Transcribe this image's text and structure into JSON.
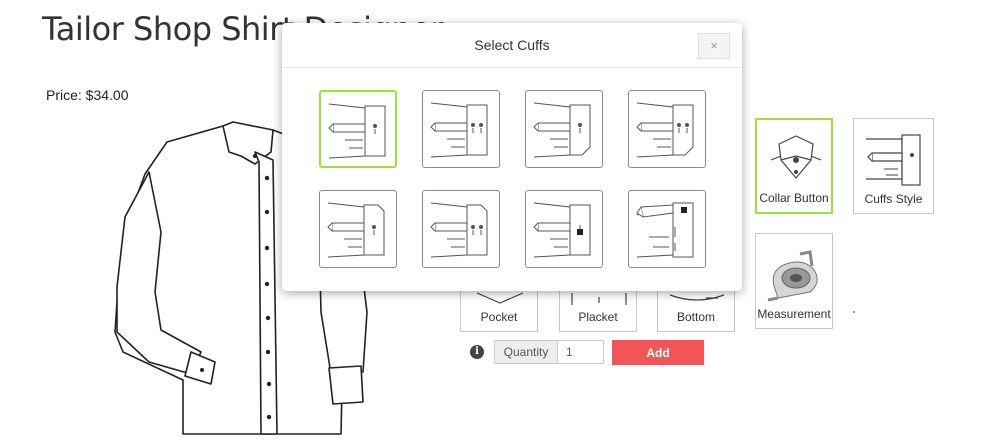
{
  "page": {
    "title": "Tailor Shop Shirt Designer",
    "price": "Price: $34.00"
  },
  "options": [
    {
      "label": "Collar Button",
      "icon": "collar-button-icon",
      "selected": true
    },
    {
      "label": "Cuffs Style",
      "icon": "cuffs-style-icon",
      "selected": false
    },
    {
      "label": "Pocket",
      "icon": "pocket-icon",
      "selected": false
    },
    {
      "label": "Placket",
      "icon": "placket-icon",
      "selected": false
    },
    {
      "label": "Bottom",
      "icon": "bottom-icon",
      "selected": false
    },
    {
      "label": "Measurement",
      "icon": "measuring-tape-icon",
      "selected": false
    }
  ],
  "cart": {
    "info_icon": "i",
    "quantity_label": "Quantity",
    "quantity_value": "1",
    "add_label": "Add"
  },
  "modal": {
    "title": "Select Cuffs",
    "close_label": "×",
    "cuffs": [
      {
        "icon": "cuff-style-1-icon",
        "selected": true
      },
      {
        "icon": "cuff-style-2-icon",
        "selected": false
      },
      {
        "icon": "cuff-style-3-icon",
        "selected": false
      },
      {
        "icon": "cuff-style-4-icon",
        "selected": false
      },
      {
        "icon": "cuff-style-5-icon",
        "selected": false
      },
      {
        "icon": "cuff-style-6-icon",
        "selected": false
      },
      {
        "icon": "cuff-style-7-icon",
        "selected": false
      },
      {
        "icon": "cuff-style-8-icon",
        "selected": false
      }
    ]
  },
  "colors": {
    "accent_green": "#9be33b",
    "add_red": "#f25555"
  }
}
